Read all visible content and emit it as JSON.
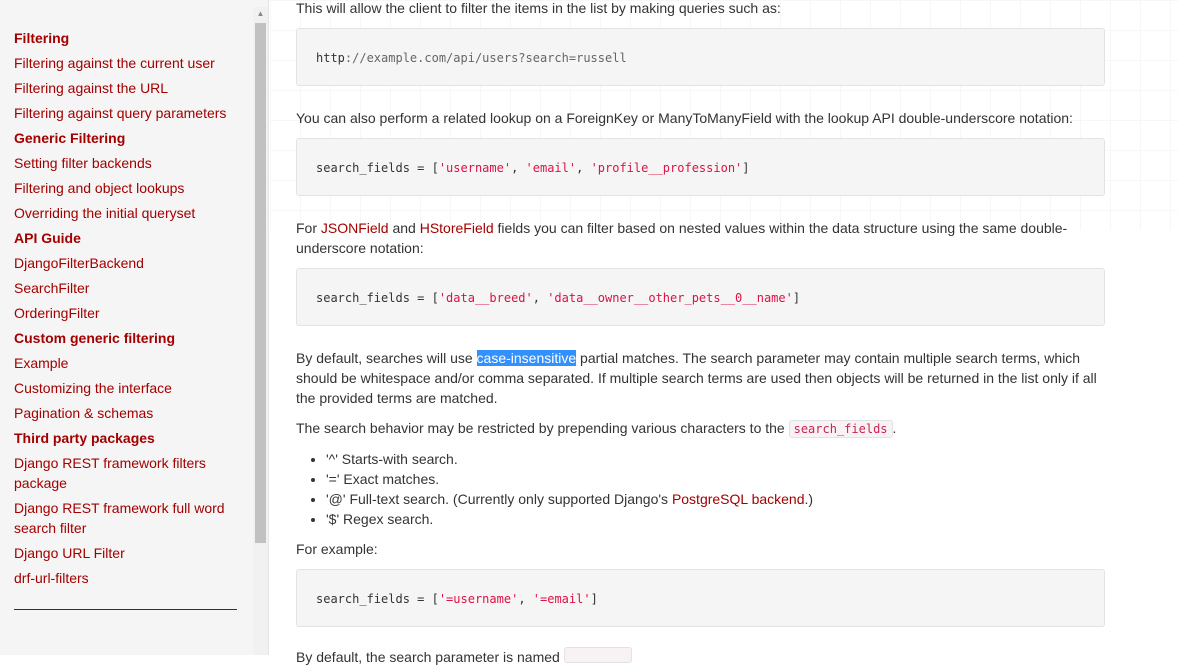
{
  "sidebar": {
    "items": [
      {
        "label": "Filtering",
        "head": true
      },
      {
        "label": "Filtering against the current user"
      },
      {
        "label": "Filtering against the URL"
      },
      {
        "label": "Filtering against query parameters"
      },
      {
        "label": "Generic Filtering",
        "head": true
      },
      {
        "label": "Setting filter backends"
      },
      {
        "label": "Filtering and object lookups"
      },
      {
        "label": "Overriding the initial queryset"
      },
      {
        "label": "API Guide",
        "head": true
      },
      {
        "label": "DjangoFilterBackend"
      },
      {
        "label": "SearchFilter"
      },
      {
        "label": "OrderingFilter"
      },
      {
        "label": "Custom generic filtering",
        "head": true
      },
      {
        "label": "Example"
      },
      {
        "label": "Customizing the interface"
      },
      {
        "label": "Pagination & schemas"
      },
      {
        "label": "Third party packages",
        "head": true
      },
      {
        "label": "Django REST framework filters package"
      },
      {
        "label": "Django REST framework full word search filter"
      },
      {
        "label": "Django URL Filter"
      },
      {
        "label": "drf-url-filters"
      }
    ]
  },
  "content": {
    "p1": "This will allow the client to filter the items in the list by making queries such as:",
    "code1": {
      "scheme": "http",
      "rest": "://example.com/api/users?search=russell"
    },
    "p2": "You can also perform a related lookup on a ForeignKey or ManyToManyField with the lookup API double-underscore notation:",
    "code2": {
      "prefix": "search_fields = [",
      "s1": "'username'",
      "s2": "'email'",
      "s3": "'profile__profession'",
      "suffix": "]"
    },
    "p3": {
      "pre": "For ",
      "link1": "JSONField",
      "mid": " and ",
      "link2": "HStoreField",
      "post": " fields you can filter based on nested values within the data structure using the same double-underscore notation:"
    },
    "code3": {
      "prefix": "search_fields = [",
      "s1": "'data__breed'",
      "s2": "'data__owner__other_pets__0__name'",
      "suffix": "]"
    },
    "p4": {
      "pre": "By default, searches will use ",
      "selected": "case-insensitive",
      "post": " partial matches. The search parameter may contain multiple search terms, which should be whitespace and/or comma separated. If multiple search terms are used then objects will be returned in the list only if all the provided terms are matched."
    },
    "p5": {
      "pre": "The search behavior may be restricted by prepending various characters to the ",
      "code": "search_fields",
      "post": "."
    },
    "options": [
      {
        "text": "'^' Starts-with search."
      },
      {
        "text": "'=' Exact matches."
      },
      {
        "pre": "'@' Full-text search. (Currently only supported Django's ",
        "link": "PostgreSQL backend",
        "post": ".)"
      },
      {
        "text": "'$' Regex search."
      }
    ],
    "p6": "For example:",
    "code4": {
      "prefix": "search_fields = [",
      "s1": "'=username'",
      "s2": "'=email'",
      "suffix": "]"
    },
    "p7": "By default, the search parameter is named"
  },
  "colors": {
    "link": "#a30000",
    "selection": "#3390ff",
    "string": "#dd1144",
    "code_bg": "#f5f5f5"
  }
}
